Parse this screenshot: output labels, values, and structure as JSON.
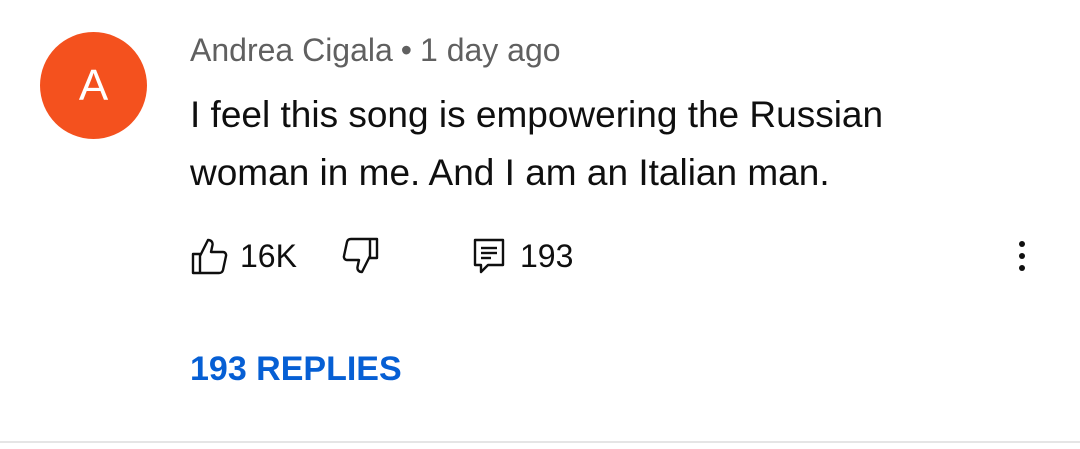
{
  "comment": {
    "avatar_letter": "A",
    "avatar_color": "#f4511e",
    "author": "Andrea Cigala",
    "separator": "•",
    "timestamp": "1 day ago",
    "text": "I feel this song is empowering the Russian woman in me. And I am an Italian man."
  },
  "actions": {
    "like_icon": "thumbs-up-icon",
    "like_count": "16K",
    "dislike_icon": "thumbs-down-icon",
    "reply_icon": "reply-icon",
    "reply_count": "193",
    "menu_icon": "more-vertical-icon"
  },
  "replies": {
    "label": "193 REPLIES",
    "color": "#065fd4"
  }
}
